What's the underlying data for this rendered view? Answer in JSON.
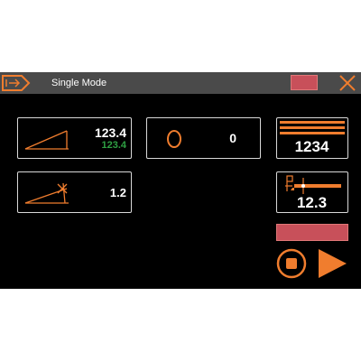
{
  "titlebar": {
    "title": "Single Mode",
    "exit_icon": "exit-arrow-icon",
    "close_icon": "close-icon"
  },
  "tiles": {
    "angle": {
      "value": "123.4",
      "secondary_value": "123.4",
      "icon": "angle-icon"
    },
    "angle_offset": {
      "value": "1.2",
      "icon": "angle-offset-icon"
    },
    "count": {
      "value": "0",
      "icon": "circle-icon"
    },
    "counter": {
      "value": "1234",
      "icon": "stacked-bars-icon"
    },
    "position": {
      "value": "12.3",
      "icon": "position-gauge-icon"
    }
  },
  "colors": {
    "accent": "#f07d2e",
    "background": "#000000",
    "titlebar": "#4a4a4a",
    "secondary_value": "#2ea043",
    "button_red": "#c8505a"
  }
}
